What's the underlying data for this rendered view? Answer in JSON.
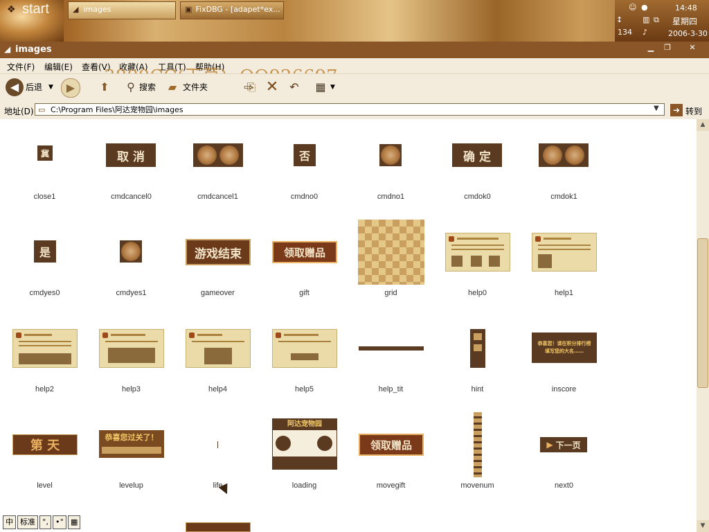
{
  "taskbar": {
    "start_label": "start",
    "buttons": [
      {
        "label": "images"
      },
      {
        "label": "FixDBG - [adapet*ex..."
      }
    ],
    "clock": {
      "time": "14:48",
      "day": "星期四",
      "date": "2006-3-30"
    },
    "tray_icon_count": "134"
  },
  "window": {
    "title": "images"
  },
  "menu": {
    "items": [
      "文件(F)",
      "编辑(E)",
      "查看(V)",
      "收藏(A)",
      "工具(T)",
      "帮助(H)"
    ],
    "watermark": "3800CC(天草)--QQ926697"
  },
  "toolbar": {
    "back_label": "后退",
    "search_label": "搜索",
    "folders_label": "文件夹"
  },
  "address": {
    "label": "地址(D)",
    "value": "C:\\Program Files\\阿达宠物园\\images",
    "go_label": "转到"
  },
  "files": [
    {
      "name": "close1",
      "kind": "small-box",
      "text": "冀"
    },
    {
      "name": "cmdcancel0",
      "kind": "button",
      "text": "取 消"
    },
    {
      "name": "cmdcancel1",
      "kind": "dots2"
    },
    {
      "name": "cmdno0",
      "kind": "small-box",
      "text": "否"
    },
    {
      "name": "cmdno1",
      "kind": "dots1"
    },
    {
      "name": "cmdok0",
      "kind": "button",
      "text": "确 定"
    },
    {
      "name": "cmdok1",
      "kind": "dots2"
    },
    {
      "name": "cmdyes0",
      "kind": "small-box",
      "text": "是"
    },
    {
      "name": "cmdyes1",
      "kind": "dots1"
    },
    {
      "name": "gameover",
      "kind": "banner",
      "text": "游戏结束"
    },
    {
      "name": "gift",
      "kind": "banner",
      "text": "领取赠品"
    },
    {
      "name": "grid",
      "kind": "grid"
    },
    {
      "name": "help0",
      "kind": "parch"
    },
    {
      "name": "help1",
      "kind": "parch"
    },
    {
      "name": "help2",
      "kind": "parch"
    },
    {
      "name": "help3",
      "kind": "parch"
    },
    {
      "name": "help4",
      "kind": "parch"
    },
    {
      "name": "help5",
      "kind": "parch"
    },
    {
      "name": "help_tit",
      "kind": "strip"
    },
    {
      "name": "hint",
      "kind": "tall-brown"
    },
    {
      "name": "inscore",
      "kind": "score-box",
      "text": "恭喜您！请在积分排行榜 填写您的大名……"
    },
    {
      "name": "level",
      "kind": "level",
      "text": "第    天"
    },
    {
      "name": "levelup",
      "kind": "levelup",
      "text": "恭喜您过关了！"
    },
    {
      "name": "life",
      "kind": "tick"
    },
    {
      "name": "loading",
      "kind": "loading",
      "text": "阿达宠物园"
    },
    {
      "name": "movegift",
      "kind": "banner",
      "text": "领取赠品"
    },
    {
      "name": "movenum",
      "kind": "vstrip"
    },
    {
      "name": "next0",
      "kind": "next",
      "text": "下一页"
    }
  ],
  "ime": {
    "buttons": [
      "中",
      "标准",
      "°,",
      "•°",
      "▦"
    ]
  }
}
